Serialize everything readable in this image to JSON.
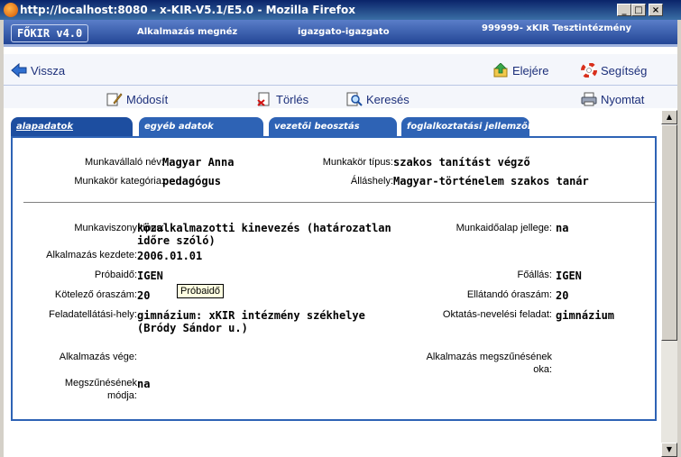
{
  "window": {
    "title": "http://localhost:8080 - x-KIR-V5.1/E5.0 - Mozilla Firefox",
    "min": "_",
    "max": "□",
    "close": "×"
  },
  "header": {
    "brand": "FŐKIR v4.0",
    "page": "Alkalmazás megnéz",
    "user": "igazgato-igazgato",
    "institution": "999999- xKIR Tesztintézmény"
  },
  "nav": {
    "back": "Vissza",
    "top": "Elejére",
    "help": "Segítség",
    "modify": "Módosít",
    "delete": "Törlés",
    "search": "Keresés",
    "print": "Nyomtat"
  },
  "tabs": [
    "alapadatok",
    "egyéb adatok",
    "vezetői beosztás",
    "foglalkoztatási jellemzők"
  ],
  "employee": {
    "name_label": "Munkavállaló név:",
    "name": "Magyar Anna",
    "jobtype_label": "Munkakör típus:",
    "jobtype": "szakos tanítást végző",
    "category_label": "Munkakör kategória:",
    "category": "pedagógus",
    "position_label": "Álláshely:",
    "position": "Magyar-történelem szakos tanár"
  },
  "employment": {
    "relation_label": "Munkaviszony típus:",
    "relation_1": "közalkalmazotti kinevezés (határozatlan",
    "relation_2": "időre szóló)",
    "worktime_label": "Munkaidőalap jellege:",
    "worktime": "na",
    "start_label": "Alkalmazás kezdete:",
    "start": "2006.01.01",
    "probation_label": "Próbaidő:",
    "probation": "IGEN",
    "main_label": "Főállás:",
    "main": "IGEN",
    "mandatory_label": "Kötelező óraszám:",
    "mandatory": "20",
    "tooltip": "Próbaidő",
    "served_label": "Ellátandó óraszám:",
    "served": "20",
    "place_label": "Feladatellátási-hely:",
    "place_1": "gimnázium: xKIR intézmény székhelye",
    "place_2": "(Bródy Sándor u.)",
    "edu_label": "Oktatás-nevelési feladat:",
    "edu": "gimnázium",
    "end_label": "Alkalmazás vége:",
    "term_reason_1": "Alkalmazás megszűnésének",
    "term_reason_2": "oka:",
    "term_mode_1": "Megszűnésének",
    "term_mode_2": "módja:",
    "term_mode": "na"
  },
  "icons": [
    "firefox-icon",
    "back-arrow-icon",
    "top-icon",
    "lifebuoy-icon",
    "edit-icon",
    "delete-icon",
    "search-icon",
    "printer-icon"
  ],
  "colors": {
    "header": "#1c3f8f",
    "tab": "#2e63b5",
    "link": "#1c2f7a"
  }
}
